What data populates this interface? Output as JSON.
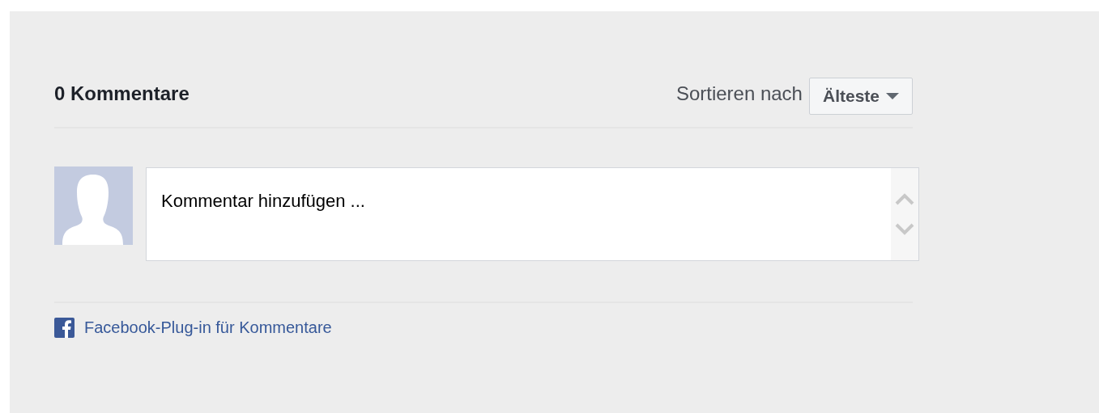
{
  "header": {
    "count_title": "0 Kommentare",
    "sort_label": "Sortieren nach",
    "sort_button": "Älteste"
  },
  "composer": {
    "placeholder": "Kommentar hinzufügen ..."
  },
  "footer": {
    "link": "Facebook-Plug-in für Kommentare"
  }
}
